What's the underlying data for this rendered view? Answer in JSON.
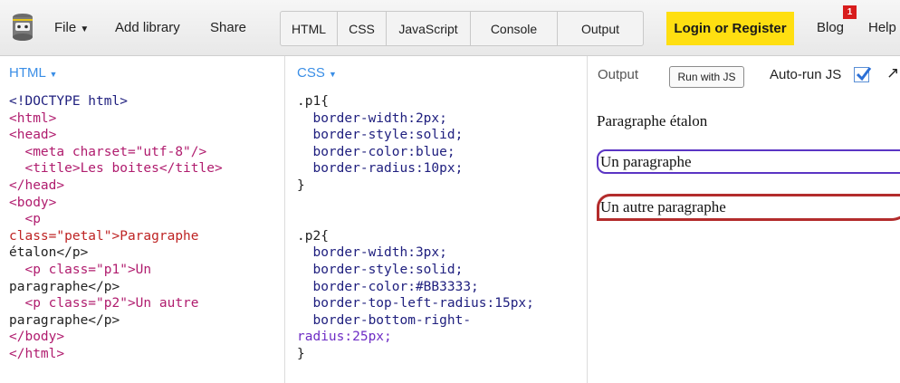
{
  "toolbar": {
    "logo_icon": "jsbin-logo-icon",
    "file_label": "File",
    "add_library_label": "Add library",
    "share_label": "Share",
    "tabs": [
      "HTML",
      "CSS",
      "JavaScript",
      "Console",
      "Output"
    ],
    "login_label": "Login or Register",
    "blog_label": "Blog",
    "blog_badge": "1",
    "help_label": "Help",
    "accent_color": "#ffdf11"
  },
  "html_panel": {
    "title": "HTML",
    "code_lines": [
      "<!DOCTYPE html>",
      "<html>",
      "<head>",
      "  <meta charset=\"utf-8\"/>",
      "  <title>Les boites</title>",
      "</head>",
      "<body>",
      "  <p",
      "class=\"petal\">Paragraphe",
      "étalon</p>",
      "  <p class=\"p1\">Un",
      "paragraphe</p>",
      "  <p class=\"p2\">Un autre",
      "paragraphe</p>",
      "</body>",
      "</html>"
    ]
  },
  "css_panel": {
    "title": "CSS",
    "code_lines": [
      ".p1{",
      "  border-width:2px;",
      "  border-style:solid;",
      "  border-color:blue;",
      "  border-radius:10px;",
      "}",
      "",
      "",
      ".p2{",
      "  border-width:3px;",
      "  border-style:solid;",
      "  border-color:#BB3333;",
      "  border-top-left-radius:15px;",
      "  border-bottom-right-",
      "radius:25px;",
      "}"
    ]
  },
  "output_panel": {
    "title": "Output",
    "run_label": "Run with JS",
    "autorun_label": "Auto-run JS",
    "autorun_checked": true,
    "expand_icon": "expand-arrow-icon",
    "paragraphs": {
      "etalon": "Paragraphe étalon",
      "p1": "Un paragraphe",
      "p2": "Un autre paragraphe"
    },
    "p1_border_color": "#5b35c4",
    "p2_border_color": "#b32c2c"
  }
}
